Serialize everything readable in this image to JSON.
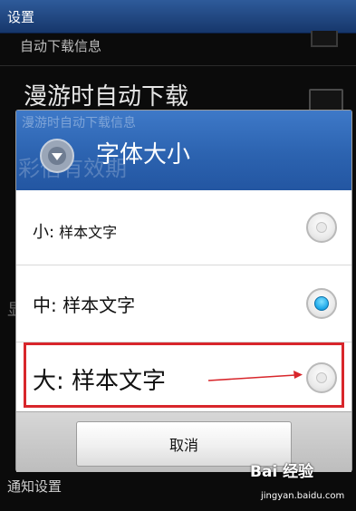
{
  "background": {
    "title": "设置",
    "items": [
      {
        "label": "自动下载信息"
      },
      {
        "label": "漫游时自动下载"
      },
      {
        "label": "彩信有效期"
      }
    ],
    "partial_left_text": "显",
    "bottom_section": "通知设置"
  },
  "dialog": {
    "header_subtext": "漫游时自动下载信息",
    "title": "字体大小",
    "icon": "dropdown-circle-icon",
    "options": [
      {
        "prefix": "小:",
        "sample": "样本文字",
        "selected": false
      },
      {
        "prefix": "中:",
        "sample": "样本文字",
        "selected": true
      },
      {
        "prefix": "大:",
        "sample": "样本文字",
        "selected": false
      }
    ],
    "cancel_label": "取消"
  },
  "annotation": {
    "highlight_color": "#d8262b"
  },
  "watermark": {
    "brand": "Bai 经验",
    "url": "jingyan.baidu.com"
  },
  "colors": {
    "titlebar": "#2356a2",
    "radio_selected": "#1aa6e8"
  }
}
